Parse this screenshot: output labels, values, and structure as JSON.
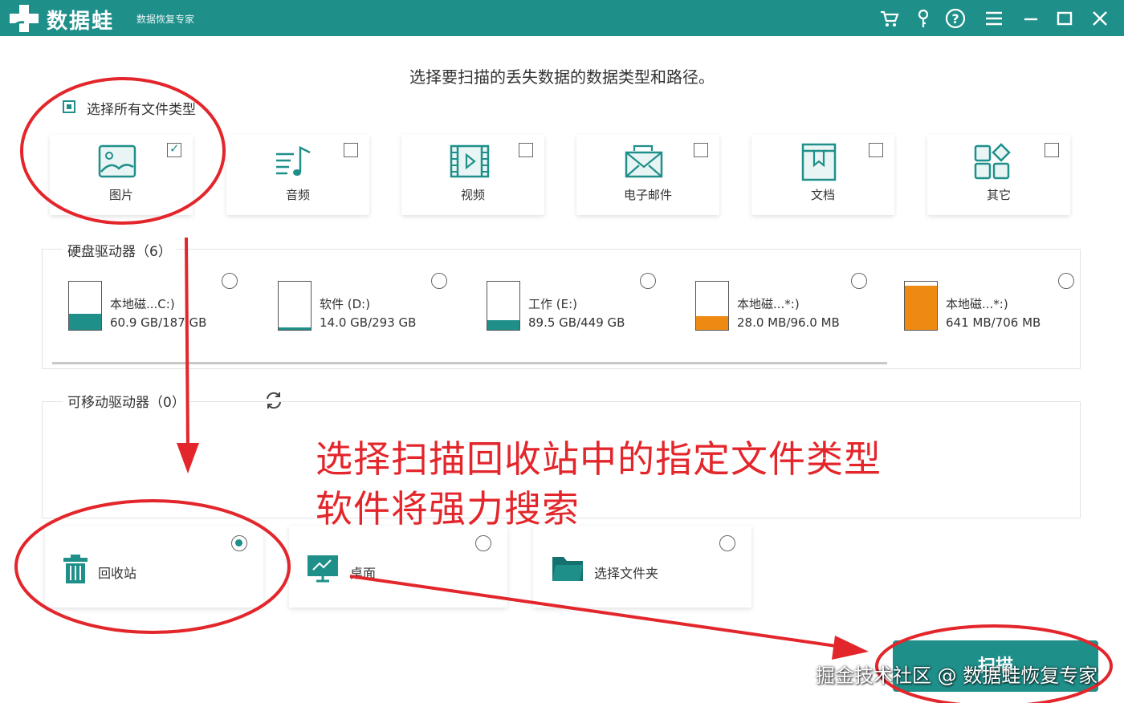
{
  "app": {
    "name": "数据蛙",
    "subtitle": "数据恢复专家",
    "accent_color": "#1f8f8a",
    "titlebar_icons": [
      "cart-icon",
      "key-icon",
      "help-icon",
      "menu-icon",
      "minimize-icon",
      "maximize-icon",
      "close-icon"
    ]
  },
  "heading": "选择要扫描的丢失数据的数据类型和路径。",
  "select_all": {
    "label": "选择所有文件类型",
    "checked": true
  },
  "file_types": [
    {
      "label": "图片",
      "icon": "image-icon",
      "checked": true
    },
    {
      "label": "音频",
      "icon": "music-icon",
      "checked": false
    },
    {
      "label": "视频",
      "icon": "video-icon",
      "checked": false
    },
    {
      "label": "电子邮件",
      "icon": "mail-icon",
      "checked": false
    },
    {
      "label": "文档",
      "icon": "document-icon",
      "checked": false
    },
    {
      "label": "其它",
      "icon": "other-icon",
      "checked": false
    }
  ],
  "hard_drives": {
    "title": "硬盘驱动器（6）",
    "drives": [
      {
        "name": "本地磁...C:)",
        "size": "60.9 GB/187 GB",
        "fill": 0.33,
        "color": "#1f8f8a"
      },
      {
        "name": "软件 (D:)",
        "size": "14.0 GB/293 GB",
        "fill": 0.05,
        "color": "#1f8f8a"
      },
      {
        "name": "工作 (E:)",
        "size": "89.5 GB/449 GB",
        "fill": 0.2,
        "color": "#1f8f8a"
      },
      {
        "name": "本地磁...*:)",
        "size": "28.0 MB/96.0 MB",
        "fill": 0.29,
        "color": "#ee8a12"
      },
      {
        "name": "本地磁...*:)",
        "size": "641 MB/706 MB",
        "fill": 0.91,
        "color": "#ee8a12"
      }
    ]
  },
  "removable": {
    "title": "可移动驱动器（0）"
  },
  "locations": [
    {
      "label": "回收站",
      "icon": "trash-icon",
      "selected": true
    },
    {
      "label": "桌面",
      "icon": "desktop-icon",
      "selected": false
    },
    {
      "label": "选择文件夹",
      "icon": "folder-icon",
      "selected": false
    }
  ],
  "scan_button": "扫描",
  "annotation": {
    "line1": "选择扫描回收站中的指定文件类型",
    "line2": "软件将强力搜索",
    "color": "#e3262b"
  },
  "watermark": "掘金技术社区 @ 数据蛙恢复专家"
}
